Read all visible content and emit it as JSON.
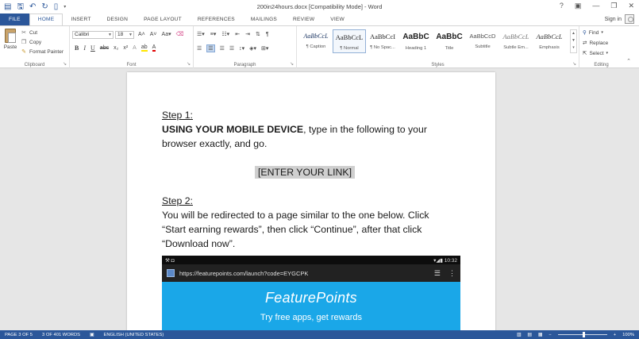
{
  "window": {
    "title": "200in24hours.docx [Compatibility Mode] - Word",
    "controls": [
      "?",
      "▣",
      "—",
      "❐",
      "✕"
    ],
    "sign_in": "Sign in"
  },
  "qat": {
    "save_icon": "save-icon",
    "undo_icon": "undo-icon",
    "redo_icon": "redo-icon",
    "new_icon": "new-document-icon"
  },
  "tabs": [
    "FILE",
    "HOME",
    "INSERT",
    "DESIGN",
    "PAGE LAYOUT",
    "REFERENCES",
    "MAILINGS",
    "REVIEW",
    "VIEW"
  ],
  "active_tab": "HOME",
  "ribbon": {
    "clipboard": {
      "label": "Clipboard",
      "paste": "Paste",
      "cut": "Cut",
      "copy": "Copy",
      "format_painter": "Format Painter"
    },
    "font": {
      "label": "Font",
      "name": "Calibri",
      "size": "18"
    },
    "paragraph": {
      "label": "Paragraph"
    },
    "styles": {
      "label": "Styles",
      "items": [
        {
          "preview": "AaBbCcL",
          "name": "¶ Caption"
        },
        {
          "preview": "AaBbCcL",
          "name": "¶ Normal"
        },
        {
          "preview": "AaBbCcI",
          "name": "¶ No Spac..."
        },
        {
          "preview": "AaBbC",
          "name": "Heading 1"
        },
        {
          "preview": "AaBbC",
          "name": "Title"
        },
        {
          "preview": "AaBbCcD",
          "name": "Subtitle"
        },
        {
          "preview": "AaBbCcL",
          "name": "Subtle Em..."
        },
        {
          "preview": "AaBbCcL",
          "name": "Emphasis"
        }
      ]
    },
    "editing": {
      "label": "Editing",
      "find": "Find",
      "replace": "Replace",
      "select": "Select"
    }
  },
  "document": {
    "step1_heading": "Step 1:",
    "step1_bold": "USING YOUR MOBILE DEVICE",
    "step1_text": ", type in the following to your browser exactly, and go.",
    "link_placeholder": "[ENTER YOUR LINK]",
    "step2_heading": "Step 2:",
    "step2_text": "You will be redirected to a page similar to the one below. Click “Start earning rewards”, then click “Continue”, after that click “Download now”.",
    "screenshot": {
      "time": "10:32",
      "url": "https://featurepoints.com/launch?code=EYGCPK",
      "brand": "FeaturePoints",
      "tagline": "Try free apps, get rewards"
    }
  },
  "status": {
    "page": "PAGE 3 OF 5",
    "words": "3 OF 401 WORDS",
    "language": "ENGLISH (UNITED STATES)",
    "zoom": "100%",
    "zoom_level": 0.5
  },
  "colors": {
    "accent": "#2b579a",
    "screenshot_bg": "#1aa7e8"
  }
}
